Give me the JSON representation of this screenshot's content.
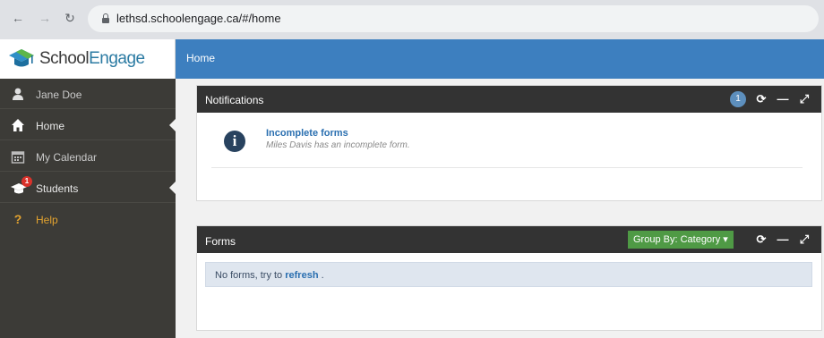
{
  "browser": {
    "url": "lethsd.schoolengage.ca/#/home",
    "back_icon": "arrow-left-icon",
    "forward_icon": "arrow-right-icon",
    "reload_icon": "reload-icon"
  },
  "brand": {
    "school": "School",
    "engage": "Engage",
    "colors": {
      "header_blue": "#3d7fbf",
      "engage_blue": "#2c7ba3"
    }
  },
  "header": {
    "title": "Home"
  },
  "sidebar": {
    "items": [
      {
        "label": "Jane Doe",
        "icon": "user-icon"
      },
      {
        "label": "Home",
        "icon": "home-icon"
      },
      {
        "label": "My Calendar",
        "icon": "calendar-icon"
      },
      {
        "label": "Students",
        "icon": "graduation-cap-icon",
        "badge": "1"
      },
      {
        "label": "Help",
        "icon": "question-icon"
      }
    ]
  },
  "notifications": {
    "title": "Notifications",
    "count": "1",
    "item": {
      "title": "Incomplete forms",
      "message": "Miles Davis has an incomplete form."
    }
  },
  "forms": {
    "title": "Forms",
    "group_by": "Group By: Category",
    "empty_prefix": "No forms, try to ",
    "empty_link": "refresh",
    "empty_suffix": " ."
  }
}
